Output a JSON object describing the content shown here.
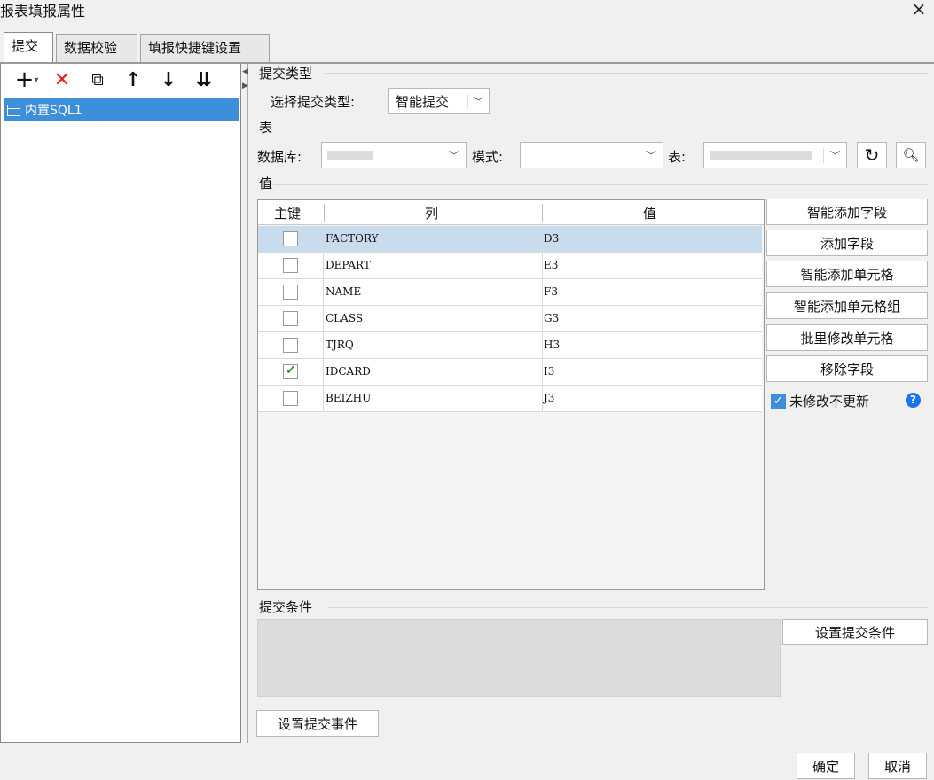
{
  "window": {
    "title": "报表填报属性",
    "close_icon": "×"
  },
  "tabs": [
    {
      "label": "提交",
      "active": true
    },
    {
      "label": "数据校验",
      "active": false
    },
    {
      "label": "填报快捷键设置",
      "active": false
    }
  ],
  "toolbar": {
    "add": "+",
    "add_dropdown": "▾",
    "delete": "✕",
    "copy": "⧉",
    "up": "↑",
    "down": "↓",
    "sort": "⇊"
  },
  "tree": {
    "items": [
      {
        "label": "内置SQL1",
        "icon": "sql-table-icon"
      }
    ]
  },
  "submit_type": {
    "section": "提交类型",
    "label": "选择提交类型:",
    "value": "智能提交"
  },
  "table_section": {
    "section": "表",
    "db_label": "数据库:",
    "db_value": "",
    "schema_label": "模式:",
    "schema_value": "",
    "table_label": "表:",
    "table_value": ""
  },
  "values_section": {
    "section": "值",
    "headers": [
      "主键",
      "列",
      "值"
    ],
    "rows": [
      {
        "key": false,
        "column": "FACTORY",
        "value": "D3",
        "selected": true
      },
      {
        "key": false,
        "column": "DEPART",
        "value": "E3",
        "selected": false
      },
      {
        "key": false,
        "column": "NAME",
        "value": "F3",
        "selected": false
      },
      {
        "key": false,
        "column": "CLASS",
        "value": "G3",
        "selected": false
      },
      {
        "key": false,
        "column": "TJRQ",
        "value": "H3",
        "selected": false
      },
      {
        "key": true,
        "column": "IDCARD",
        "value": "I3",
        "selected": false
      },
      {
        "key": false,
        "column": "BEIZHU",
        "value": "J3",
        "selected": false
      }
    ]
  },
  "side_buttons": {
    "smart_add_field": "智能添加字段",
    "add_field": "添加字段",
    "smart_add_cell": "智能添加单元格",
    "smart_add_cell_group": "智能添加单元格组",
    "batch_edit_cell": "批里修改单元格",
    "remove_field": "移除字段",
    "no_update_unmodified": "未修改不更新",
    "no_update_checked": true,
    "help": "?"
  },
  "condition": {
    "section": "提交条件",
    "set_button": "设置提交条件"
  },
  "event_button": "设置提交事件",
  "footer": {
    "ok": "确定",
    "cancel": "取消"
  },
  "colors": {
    "accent": "#3d8fdb",
    "selected_row": "#c9dced",
    "delete_red": "#e02020",
    "help_blue": "#1a73e8"
  }
}
